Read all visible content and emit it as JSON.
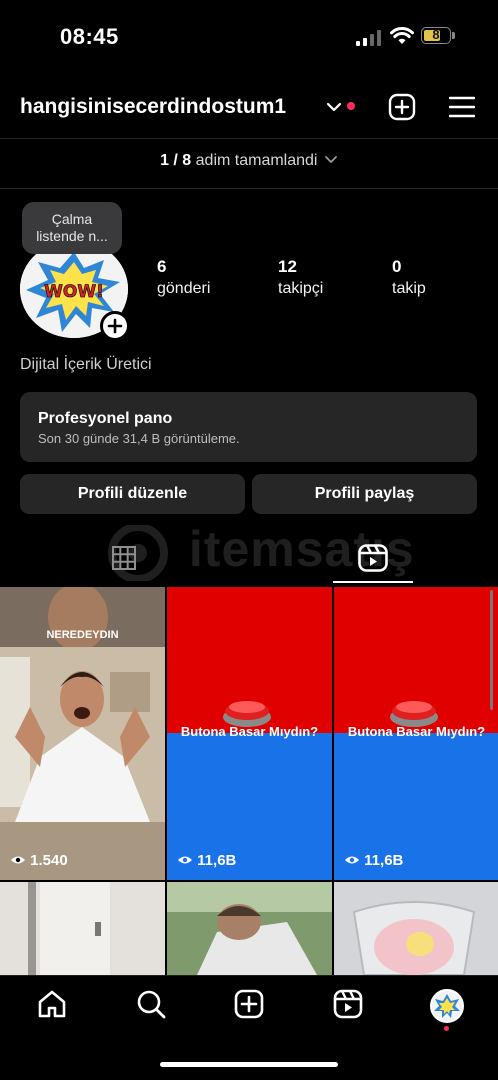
{
  "status": {
    "time": "08:45",
    "battery": "8"
  },
  "header": {
    "username": "hangisinisecerdindostum1"
  },
  "steps": {
    "count": "1 / 8",
    "text": "adim tamamlandi"
  },
  "tooltip": {
    "line1": "Çalma",
    "line2": "listende n..."
  },
  "stats": [
    {
      "value": "6",
      "label": "gönderi"
    },
    {
      "value": "12",
      "label": "takipçi"
    },
    {
      "value": "0",
      "label": "takip"
    }
  ],
  "bio": "Dijital İçerik Üretici",
  "dashboard": {
    "title": "Profesyonel pano",
    "subtitle": "Son 30 günde 31,4 B görüntüleme."
  },
  "buttons": {
    "edit": "Profili düzenle",
    "share": "Profili paylaş"
  },
  "watermark": "itemsatış",
  "avatar_text": "WOW!",
  "reels": [
    {
      "caption": "NEREDEYDIN",
      "views": "1.540"
    },
    {
      "caption": "Butona Basar Mıydın?",
      "views": "11,6B"
    },
    {
      "caption": "Butona Basar Mıydın?",
      "views": "11,6B"
    }
  ],
  "colors": {
    "accent_red": "#ff2d55",
    "background": "#000000",
    "card": "#262626",
    "reel_red": "#e00000",
    "reel_blue": "#1a72e8"
  }
}
